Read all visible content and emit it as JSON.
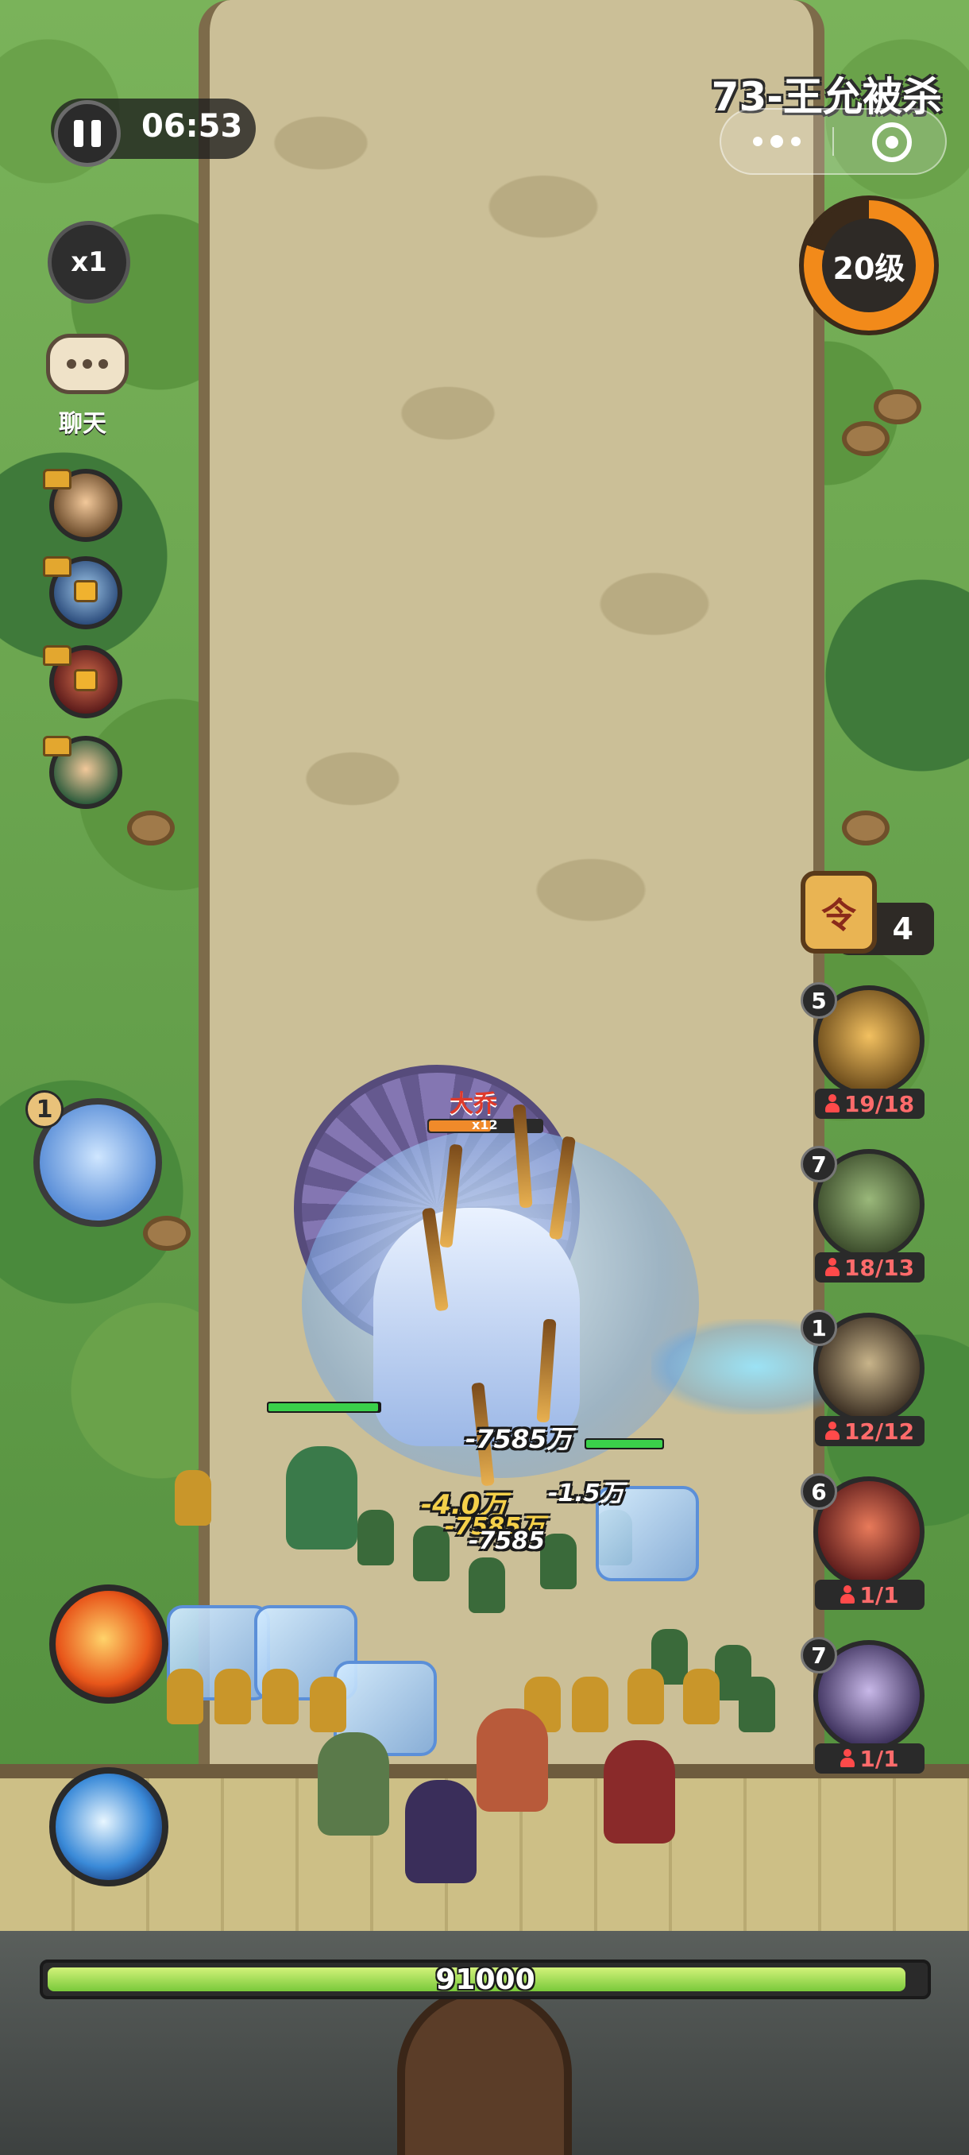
{
  "hud": {
    "timer": "06:53",
    "speed": "x1",
    "chat_label": "聊天",
    "stage_title": "73-王允被杀",
    "level": "20级",
    "level_progress_fraction": 0.8,
    "order_count": "4",
    "order_badge_char": "令"
  },
  "heroes_left": [
    {
      "name": "hero-avatar-1",
      "locked": false
    },
    {
      "name": "hero-avatar-2",
      "locked": true
    },
    {
      "name": "hero-avatar-3",
      "locked": true
    },
    {
      "name": "hero-avatar-4",
      "locked": false
    }
  ],
  "boss_card": {
    "count": "1"
  },
  "units": [
    {
      "level": "5",
      "count": "19/18"
    },
    {
      "level": "7",
      "count": "18/13"
    },
    {
      "level": "1",
      "count": "12/12"
    },
    {
      "level": "6",
      "count": "1/1"
    },
    {
      "level": "7",
      "count": "1/1"
    }
  ],
  "boss": {
    "name": "大乔",
    "multiplier": "x12",
    "hp_fraction": 0.55
  },
  "damage_texts": [
    "-7585万",
    "-4.0万",
    "-1.5万",
    "-7585万",
    "-7585"
  ],
  "wall_hp": {
    "value": "91000",
    "fraction": 0.98
  },
  "colors": {
    "accent_orange": "#f28a1a",
    "hp_green": "#79c93a",
    "danger_red": "#ff4a4a",
    "boss_name_red": "#e03a2a"
  }
}
